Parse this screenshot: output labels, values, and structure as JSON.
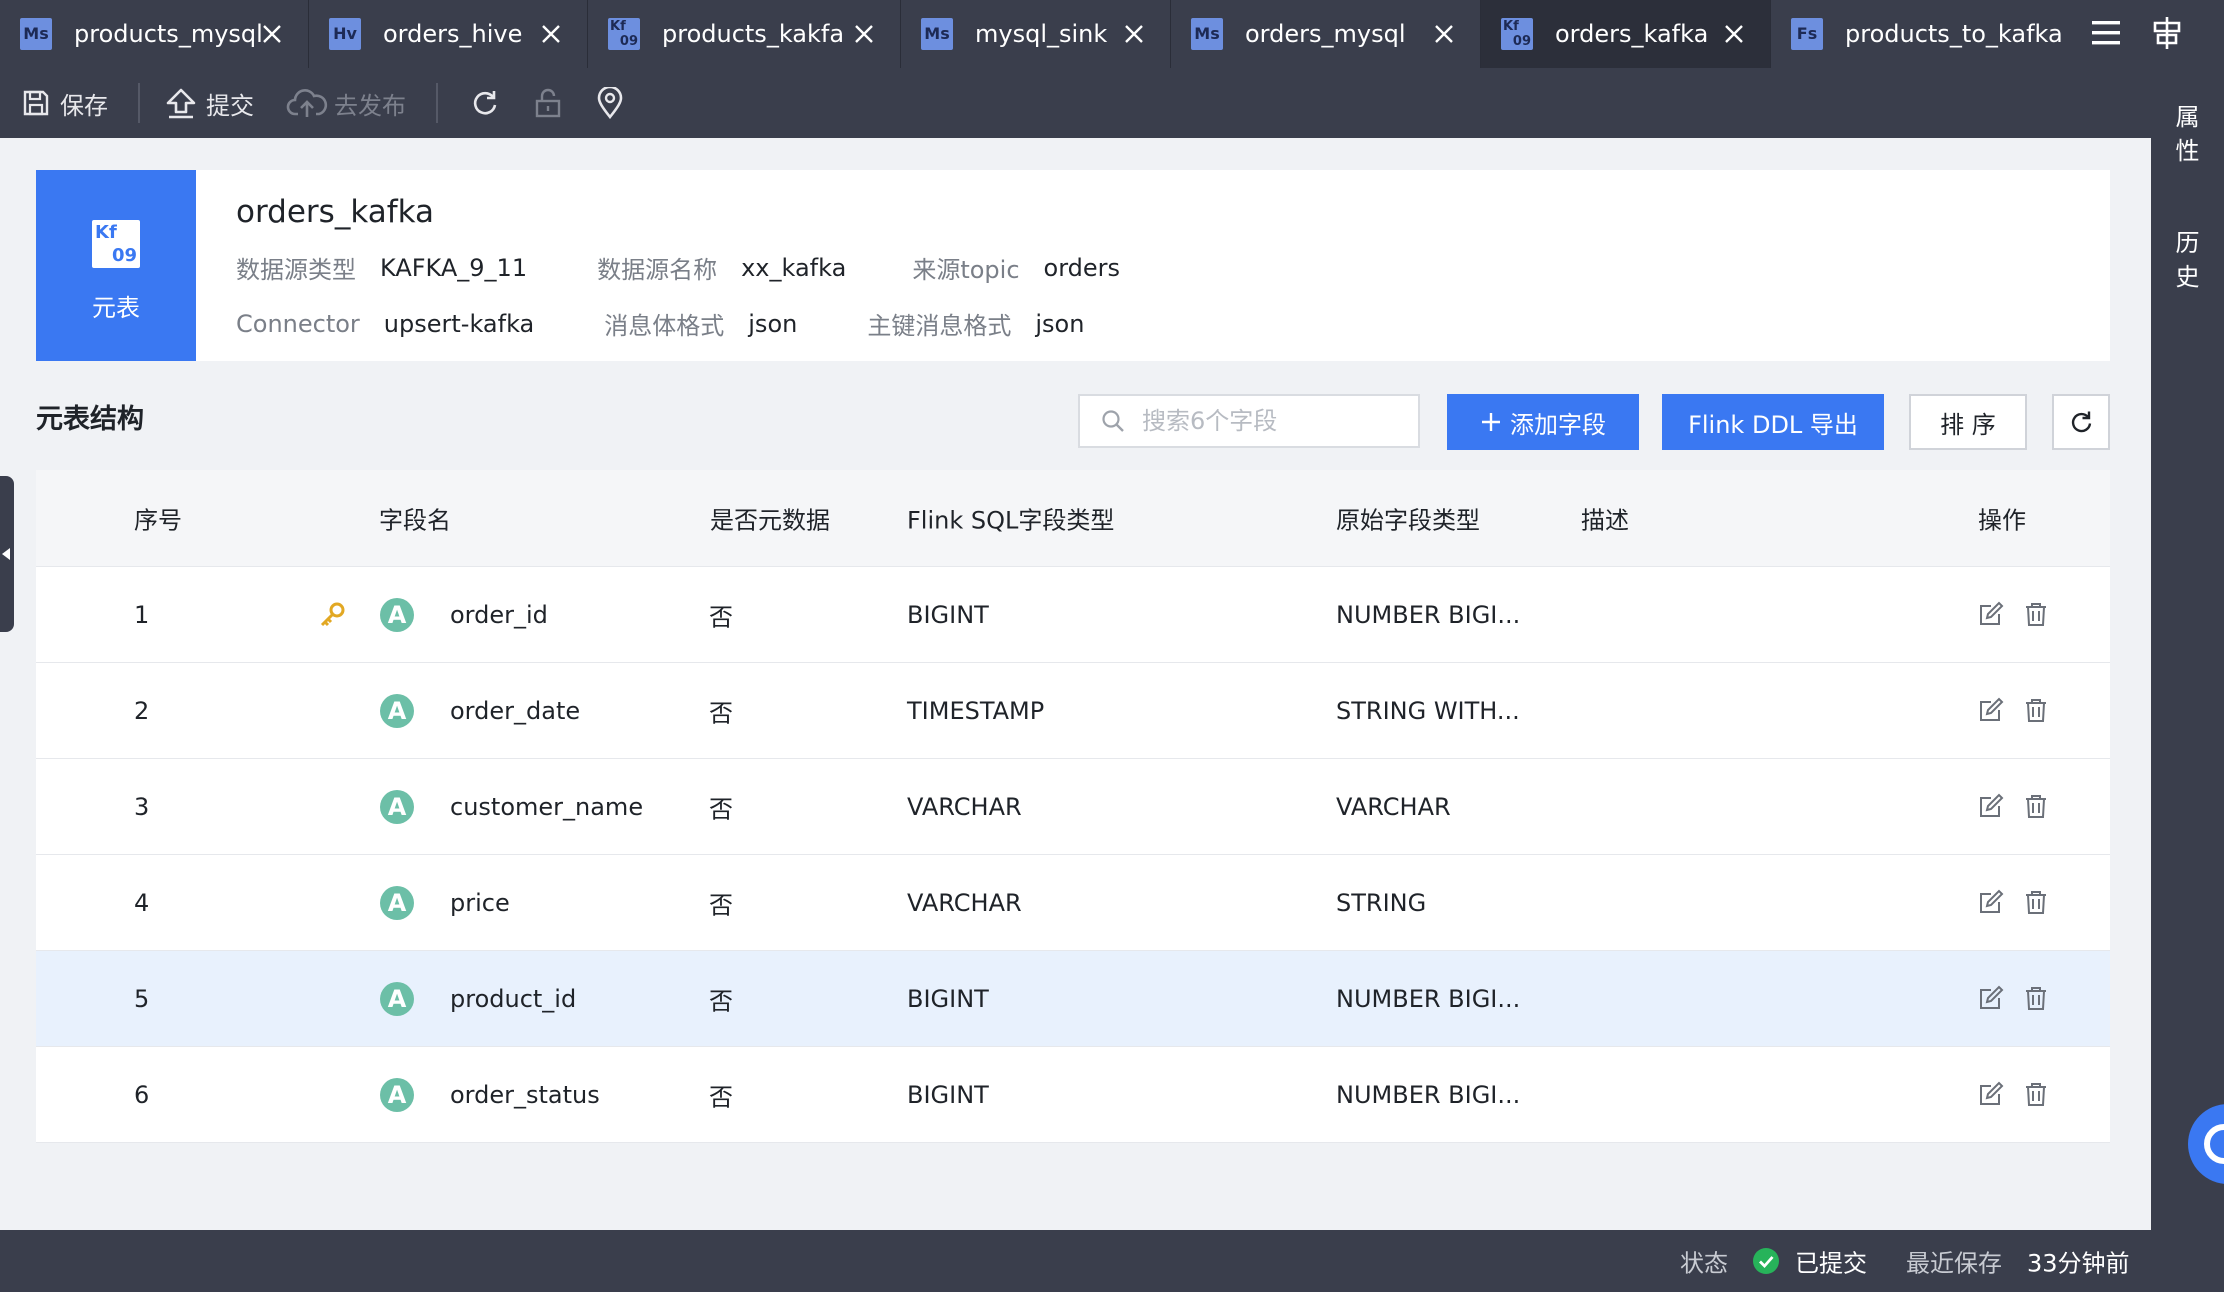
{
  "tabs": [
    {
      "badge": "Ms",
      "label": "products_mysql",
      "active": false
    },
    {
      "badge": "Hv",
      "label": "orders_hive",
      "active": false
    },
    {
      "badge": "Kf 09",
      "label": "products_kakfa",
      "active": false
    },
    {
      "badge": "Ms",
      "label": "mysql_sink",
      "active": false
    },
    {
      "badge": "Ms",
      "label": "orders_mysql",
      "active": false
    },
    {
      "badge": "Kf 09",
      "label": "orders_kafka",
      "active": true
    },
    {
      "badge": "Fs",
      "label": "products_to_kafka",
      "active": false
    }
  ],
  "toolbar": {
    "save_label": "保存",
    "submit_label": "提交",
    "publish_label": "去发布"
  },
  "right_panel": {
    "properties_label": "属\n性",
    "history_label": "历\n史"
  },
  "meta": {
    "icon_top": "Kf",
    "icon_bottom": "09",
    "kind_label": "元表",
    "title": "orders_kafka",
    "source_type_label": "数据源类型",
    "source_type": "KAFKA_9_11",
    "source_name_label": "数据源名称",
    "source_name": "xx_kafka",
    "topic_label": "来源topic",
    "topic": "orders",
    "connector_label": "Connector",
    "connector": "upsert-kafka",
    "body_format_label": "消息体格式",
    "body_format": "json",
    "key_format_label": "主键消息格式",
    "key_format": "json"
  },
  "section": {
    "title": "元表结构",
    "search_placeholder": "搜索6个字段",
    "add_field_label": "添加字段",
    "export_label": "Flink DDL 导出",
    "sort_label": "排 序"
  },
  "table": {
    "headers": {
      "index": "序号",
      "field_name": "字段名",
      "is_meta": "是否元数据",
      "flink_type": "Flink SQL字段类型",
      "raw_type": "原始字段类型",
      "description": "描述",
      "actions": "操作"
    },
    "rows": [
      {
        "index": "1",
        "primary_key": true,
        "type_badge": "A",
        "name": "order_id",
        "is_meta": "否",
        "flink_type": "BIGINT",
        "raw_type": "NUMBER BIGI...",
        "description": ""
      },
      {
        "index": "2",
        "primary_key": false,
        "type_badge": "A",
        "name": "order_date",
        "is_meta": "否",
        "flink_type": "TIMESTAMP",
        "raw_type": "STRING WITH...",
        "description": ""
      },
      {
        "index": "3",
        "primary_key": false,
        "type_badge": "A",
        "name": "customer_name",
        "is_meta": "否",
        "flink_type": "VARCHAR",
        "raw_type": "VARCHAR",
        "description": ""
      },
      {
        "index": "4",
        "primary_key": false,
        "type_badge": "A",
        "name": "price",
        "is_meta": "否",
        "flink_type": "VARCHAR",
        "raw_type": "STRING",
        "description": ""
      },
      {
        "index": "5",
        "primary_key": false,
        "type_badge": "A",
        "name": "product_id",
        "is_meta": "否",
        "flink_type": "BIGINT",
        "raw_type": "NUMBER BIGI...",
        "description": "",
        "highlighted": true
      },
      {
        "index": "6",
        "primary_key": false,
        "type_badge": "A",
        "name": "order_status",
        "is_meta": "否",
        "flink_type": "BIGINT",
        "raw_type": "NUMBER BIGI...",
        "description": ""
      }
    ]
  },
  "status": {
    "status_label": "状态",
    "status_value": "已提交",
    "last_saved_label": "最近保存",
    "last_saved_value": "33分钟前"
  },
  "colors": {
    "accent": "#3a78f2",
    "chrome": "#3a3e4c",
    "badge": "#6cbfa7",
    "success": "#27b35a",
    "key": "#e2a823"
  },
  "icons": {
    "tab_close": "close-icon",
    "menu": "hamburger-menu-icon",
    "layout": "layout-icon",
    "save": "save-icon",
    "submit": "upload-icon",
    "publish": "cloud-upload-icon",
    "refresh": "refresh-icon",
    "lock": "lock-icon",
    "locate": "location-pin-icon",
    "search": "search-icon",
    "add": "plus-icon",
    "edit": "edit-icon",
    "delete": "trash-icon",
    "primary_key": "key-icon",
    "status_ok": "check-circle-icon"
  }
}
